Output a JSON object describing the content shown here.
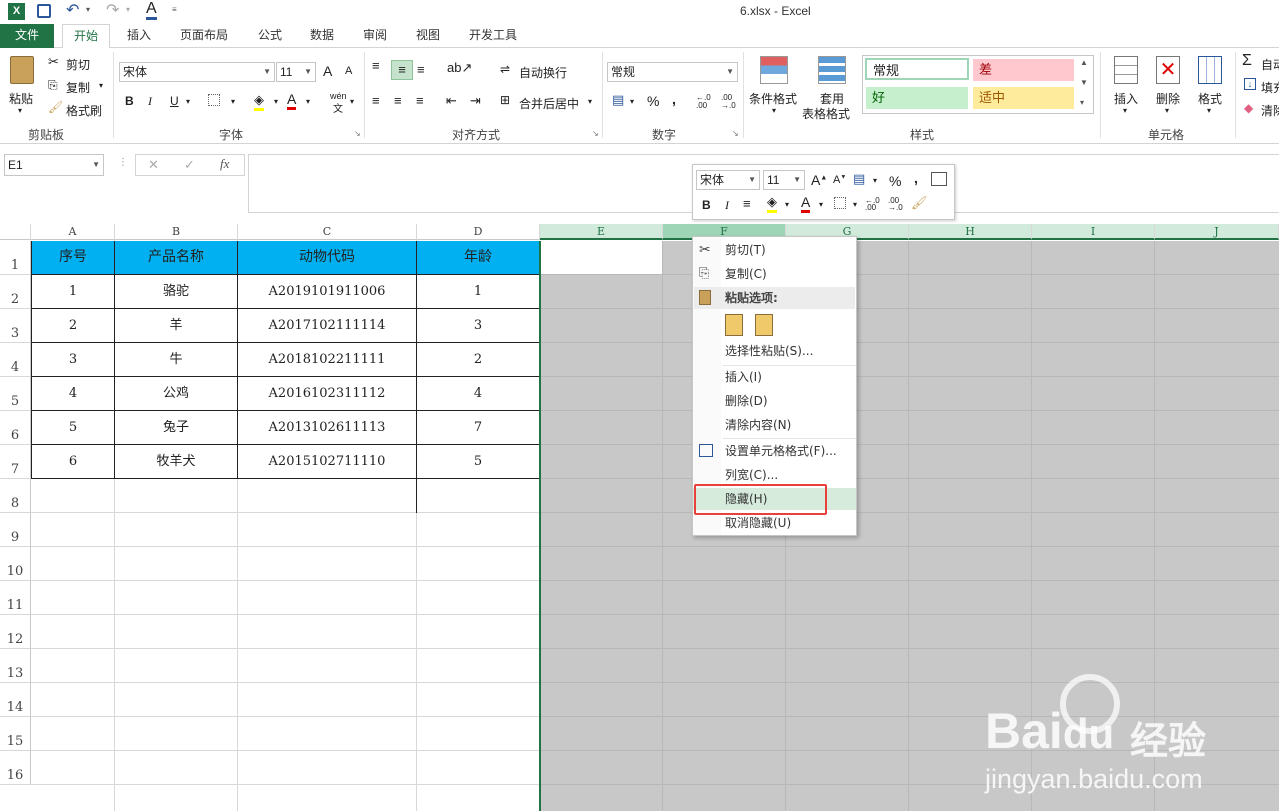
{
  "window": {
    "title": "6.xlsx - Excel",
    "file_icon": "X"
  },
  "tabs": [
    {
      "label": "文件"
    },
    {
      "label": "开始"
    },
    {
      "label": "插入"
    },
    {
      "label": "页面布局"
    },
    {
      "label": "公式"
    },
    {
      "label": "数据"
    },
    {
      "label": "审阅"
    },
    {
      "label": "视图"
    },
    {
      "label": "开发工具"
    }
  ],
  "ribbon": {
    "clipboard": {
      "paste": "粘贴",
      "cut": "剪切",
      "copy": "复制",
      "format_painter": "格式刷",
      "group": "剪贴板"
    },
    "font": {
      "name": "宋体",
      "size": "11",
      "bold": "B",
      "italic": "I",
      "underline": "U",
      "font_color": "A",
      "wen": "wén",
      "wen2": "文",
      "grow": "A",
      "shrink": "A",
      "group": "字体"
    },
    "align": {
      "wrap": "自动换行",
      "merge": "合并后居中",
      "group": "对齐方式"
    },
    "number": {
      "format": "常规",
      "percent": "%",
      "comma": ",",
      "inc": "←.0 .00",
      "dec": ".00 →.0",
      "group": "数字"
    },
    "styles": {
      "cond": "条件格式",
      "table1": "套用",
      "table2": "表格格式",
      "normal": "常规",
      "bad": "差",
      "good": "好",
      "neutral": "适中",
      "group": "样式"
    },
    "cells": {
      "insert": "插入",
      "delete": "删除",
      "format": "格式",
      "group": "单元格"
    },
    "edit": {
      "autosum": "自动",
      "fill": "填充",
      "clear": "清除"
    }
  },
  "formula_bar": {
    "name_box": "E1",
    "fx": "fx",
    "cancel": "✕",
    "enter": "✓"
  },
  "columns": [
    "A",
    "B",
    "C",
    "D",
    "E",
    "F",
    "G",
    "H",
    "I",
    "J"
  ],
  "rows": [
    "1",
    "2",
    "3",
    "4",
    "5",
    "6",
    "7",
    "8",
    "9",
    "10",
    "11",
    "12",
    "13",
    "14",
    "15",
    "16"
  ],
  "table": {
    "headers": [
      "序号",
      "产品名称",
      "动物代码",
      "年龄"
    ],
    "rows": [
      [
        "1",
        "骆驼",
        "A2019101911006",
        "1"
      ],
      [
        "2",
        "羊",
        "A2017102111114",
        "3"
      ],
      [
        "3",
        "牛",
        "A2018102211111",
        "2"
      ],
      [
        "4",
        "公鸡",
        "A2016102311112",
        "4"
      ],
      [
        "5",
        "兔子",
        "A2013102611113",
        "7"
      ],
      [
        "6",
        "牧羊犬",
        "A2015102711110",
        "5"
      ]
    ]
  },
  "mini_toolbar": {
    "font": "宋体",
    "size": "11"
  },
  "context_menu": {
    "cut": "剪切(T)",
    "copy": "复制(C)",
    "paste_options": "粘贴选项:",
    "paste_special": "选择性粘贴(S)...",
    "insert": "插入(I)",
    "delete": "删除(D)",
    "clear": "清除内容(N)",
    "format_cells": "设置单元格格式(F)...",
    "col_width": "列宽(C)...",
    "hide": "隐藏(H)",
    "unhide": "取消隐藏(U)"
  },
  "watermark": {
    "text1": "Bai",
    "text2": "du",
    "text3": "经验",
    "url": "jingyan.baidu.com"
  },
  "colors": {
    "excel_green": "#217346",
    "header_fill": "#00b0f0",
    "selected_fill": "#c8c8c8",
    "highlight_red": "#e8413c"
  }
}
